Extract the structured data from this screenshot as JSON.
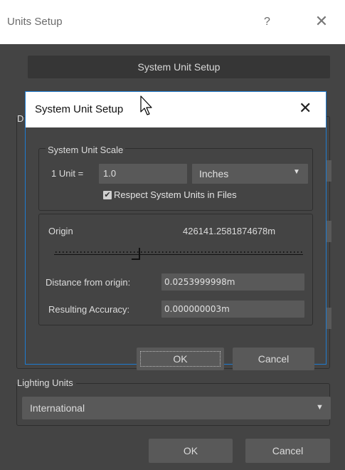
{
  "outer": {
    "title": "Units Setup",
    "help_glyph": "?",
    "close_glyph": "✕",
    "system_unit_setup_button": "System Unit Setup",
    "display_unit_scale_label_partial": "D",
    "lighting_units_label": "Lighting Units",
    "lighting_units_value": "International",
    "ok_label": "OK",
    "cancel_label": "Cancel"
  },
  "dialog": {
    "title": "System Unit Setup",
    "close_glyph": "✕",
    "system_unit_scale": {
      "group_label": "System Unit Scale",
      "unit_label": "1 Unit =",
      "unit_value": "1.0",
      "unit_type": "Inches",
      "respect_checked": true,
      "respect_label": "Respect System Units in Files"
    },
    "origin": {
      "label": "Origin",
      "value": "426141.2581874678m",
      "slider_position": 0.34,
      "distance_label": "Distance from origin:",
      "distance_value": "0.0253999998m",
      "accuracy_label": "Resulting Accuracy:",
      "accuracy_value": "0.000000003m"
    },
    "ok_label": "OK",
    "cancel_label": "Cancel"
  },
  "colors": {
    "panel": "#444444",
    "field": "#595959",
    "accent_border": "#1e7bd0",
    "titlebar": "#ffffff"
  },
  "icons": {
    "close": "close-icon",
    "chevron": "chevron-down-icon",
    "check": "checkmark-icon",
    "cursor": "mouse-cursor-icon"
  }
}
